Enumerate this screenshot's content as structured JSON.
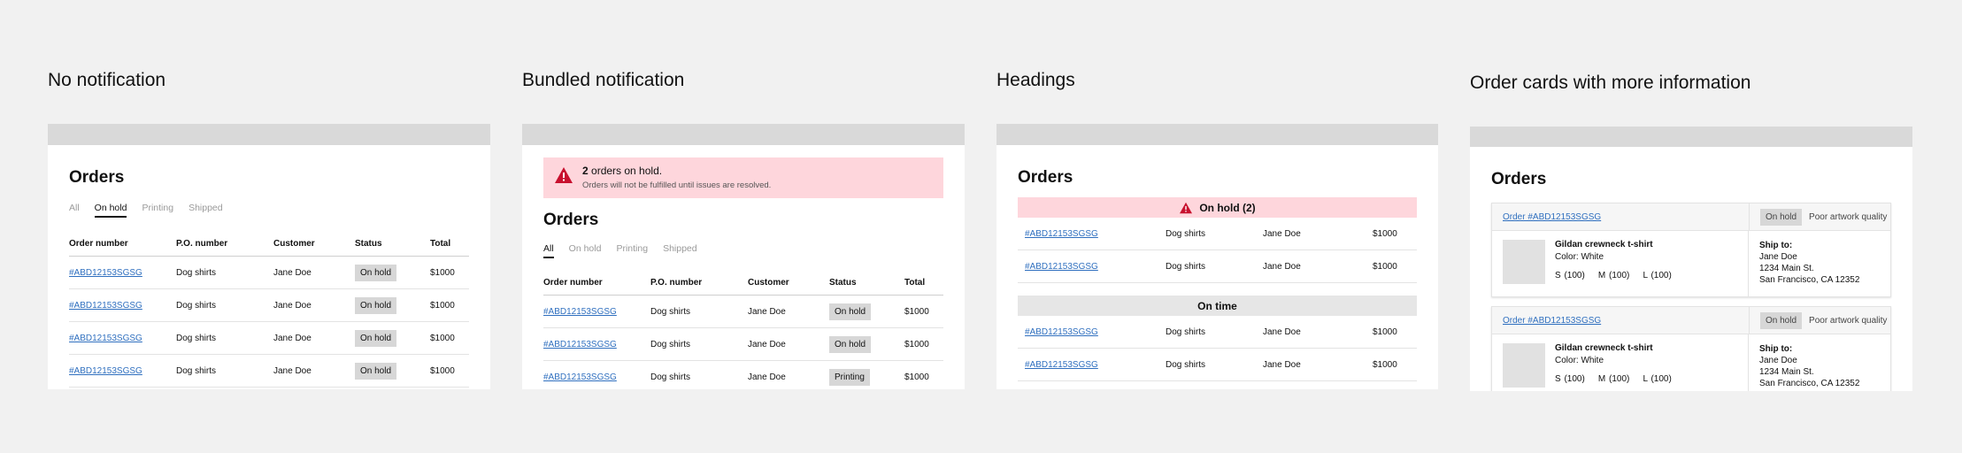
{
  "columns": [
    {
      "title": "No notification"
    },
    {
      "title": "Bundled notification"
    },
    {
      "title": "Headings"
    },
    {
      "title": "Order cards with more information"
    }
  ],
  "orders_title": "Orders",
  "tabs": [
    "All",
    "On hold",
    "Printing",
    "Shipped"
  ],
  "table_headers": [
    "Order number",
    "P.O. number",
    "Customer",
    "Status",
    "Total"
  ],
  "p1_rows": [
    {
      "order": "#ABD12153SGSG",
      "po": "Dog shirts",
      "customer": "Jane Doe",
      "status": "On hold",
      "total": "$1000"
    },
    {
      "order": "#ABD12153SGSG",
      "po": "Dog shirts",
      "customer": "Jane Doe",
      "status": "On hold",
      "total": "$1000"
    },
    {
      "order": "#ABD12153SGSG",
      "po": "Dog shirts",
      "customer": "Jane Doe",
      "status": "On hold",
      "total": "$1000"
    },
    {
      "order": "#ABD12153SGSG",
      "po": "Dog shirts",
      "customer": "Jane Doe",
      "status": "On hold",
      "total": "$1000"
    }
  ],
  "alert": {
    "count": "2",
    "line1": "orders on hold.",
    "line2": "Orders will not be fulfilled until issues are resolved."
  },
  "p2_rows": [
    {
      "order": "#ABD12153SGSG",
      "po": "Dog shirts",
      "customer": "Jane Doe",
      "status": "On hold",
      "total": "$1000"
    },
    {
      "order": "#ABD12153SGSG",
      "po": "Dog shirts",
      "customer": "Jane Doe",
      "status": "On hold",
      "total": "$1000"
    },
    {
      "order": "#ABD12153SGSG",
      "po": "Dog shirts",
      "customer": "Jane Doe",
      "status": "Printing",
      "total": "$1000"
    }
  ],
  "groups": [
    {
      "heading": "On hold (2)",
      "rows": [
        {
          "order": "#ABD12153SGSG",
          "po": "Dog shirts",
          "customer": "Jane Doe",
          "total": "$1000"
        },
        {
          "order": "#ABD12153SGSG",
          "po": "Dog shirts",
          "customer": "Jane Doe",
          "total": "$1000"
        }
      ]
    },
    {
      "heading": "On time",
      "rows": [
        {
          "order": "#ABD12153SGSG",
          "po": "Dog shirts",
          "customer": "Jane Doe",
          "total": "$1000"
        },
        {
          "order": "#ABD12153SGSG",
          "po": "Dog shirts",
          "customer": "Jane Doe",
          "total": "$1000"
        }
      ]
    }
  ],
  "cards": [
    {
      "order": "Order #ABD12153SGSG",
      "status": "On hold",
      "reason": "Poor artwork quality",
      "product": "Gildan crewneck t-shirt",
      "color": "Color: White",
      "sizes": "S (100)    M (100)    L (100)",
      "ship_label": "Ship to:",
      "ship_name": "Jane Doe",
      "ship_street": "1234 Main St.",
      "ship_city": "San Francisco, CA 12352"
    },
    {
      "order": "Order #ABD12153SGSG",
      "status": "On hold",
      "reason": "Poor artwork quality",
      "product": "Gildan crewneck t-shirt",
      "color": "Color: White",
      "sizes": "S (100)    M (100)    L (100)",
      "ship_label": "Ship to:",
      "ship_name": "Jane Doe",
      "ship_street": "1234 Main St.",
      "ship_city": "San Francisco, CA 12352"
    }
  ],
  "colors": {
    "background": "#f1f1f1",
    "alert_bg": "#fed6dc",
    "alert_icon": "#c8102e",
    "link": "#2f6fbf",
    "badge": "#d7d7d7"
  },
  "icons": {
    "alert": "warning-triangle-icon"
  }
}
